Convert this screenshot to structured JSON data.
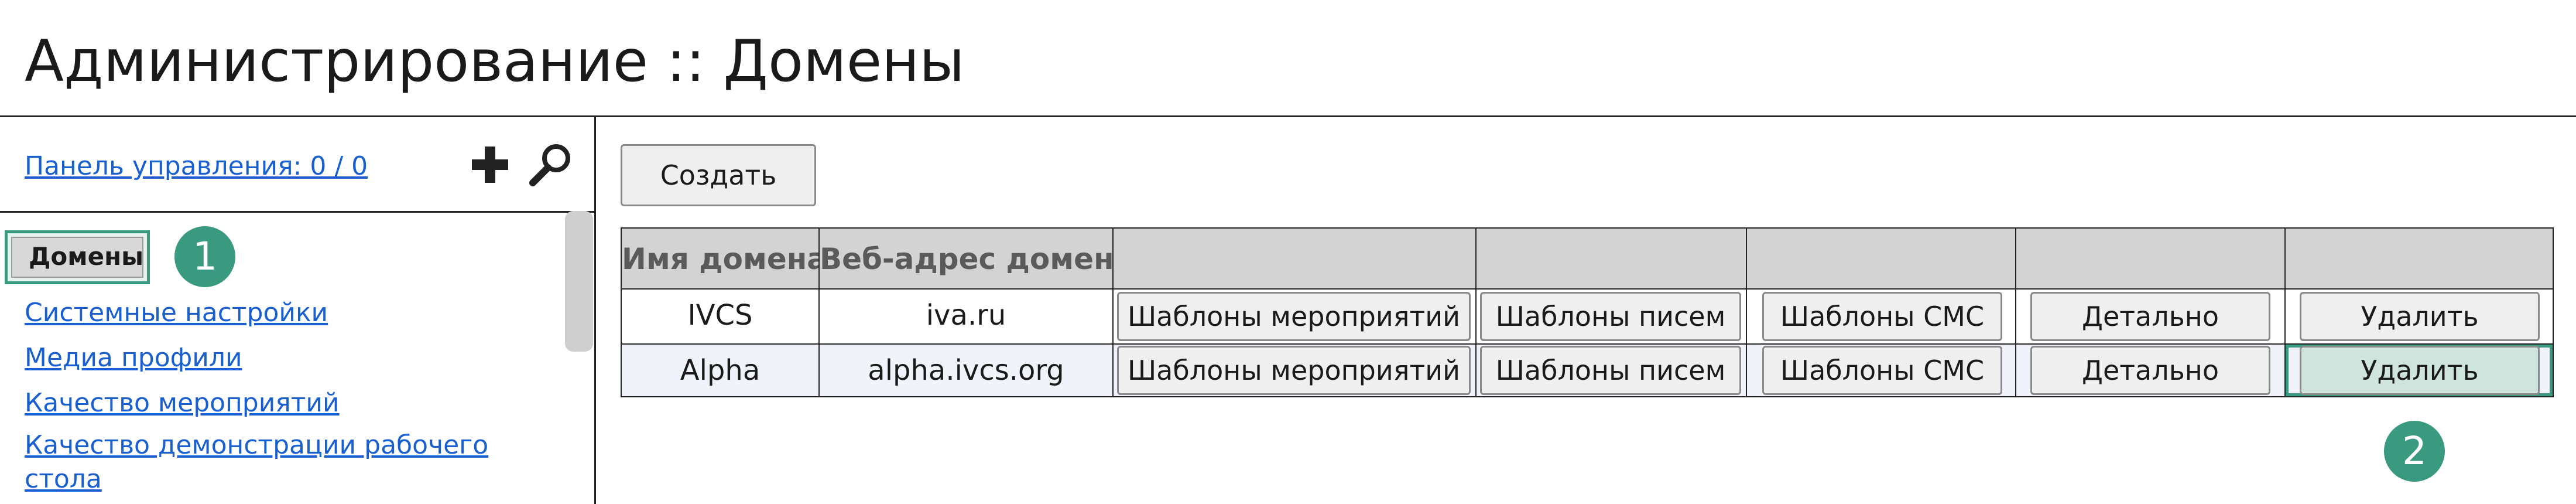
{
  "header": {
    "title": "Администрирование :: Домены"
  },
  "sidebar": {
    "dashboard_link": "Панель управления: 0 / 0",
    "add_icon": "plus-icon",
    "search_icon": "search-icon",
    "items": [
      {
        "label": "Домены",
        "active": true
      },
      {
        "label": "Системные настройки"
      },
      {
        "label": "Медиа профили"
      },
      {
        "label": "Качество мероприятий"
      },
      {
        "label": "Качество демонстрации рабочего стола"
      }
    ]
  },
  "main": {
    "create_button": "Создать",
    "table": {
      "headers": [
        "Имя домена",
        "Веб-адрес домена",
        "",
        "",
        "",
        "",
        ""
      ],
      "rows": [
        {
          "name": "IVCS",
          "url": "iva.ru",
          "actions": [
            "Шаблоны мероприятий",
            "Шаблоны писем",
            "Шаблоны СМС",
            "Детально",
            "Удалить"
          ]
        },
        {
          "name": "Alpha",
          "url": "alpha.ivcs.org",
          "actions": [
            "Шаблоны мероприятий",
            "Шаблоны писем",
            "Шаблоны СМС",
            "Детально",
            "Удалить"
          ]
        }
      ]
    }
  },
  "callouts": [
    "1",
    "2"
  ],
  "colors": {
    "accent": "#3a9a80",
    "link": "#1a5fd0",
    "header_bg": "#d3d3d3",
    "alt_row": "#f0f4fa"
  }
}
